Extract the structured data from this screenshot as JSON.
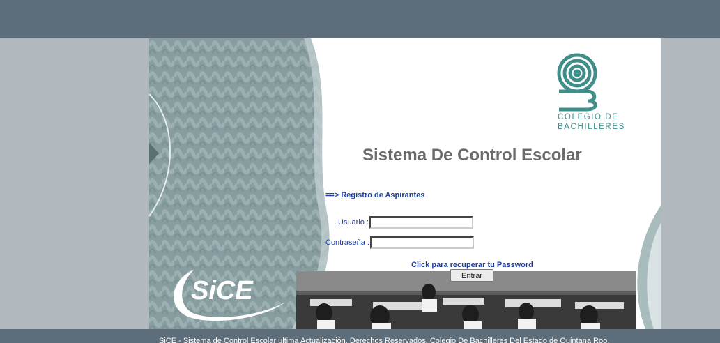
{
  "brand": {
    "logo_line1": "COLEGIO DE",
    "logo_line2": "BACHILLERES",
    "logo_color": "#3f8e8a",
    "sice_logo_text": "SiCE"
  },
  "header": {
    "title": "Sistema De Control Escolar"
  },
  "links": {
    "registro": "==> Registro de Aspirantes",
    "recover": "Click para recuperar tu Password"
  },
  "login": {
    "user_label": "Usuario :",
    "user_value": "",
    "pass_label": "Contraseña :",
    "pass_value": "",
    "submit_label": "Entrar"
  },
  "footer": {
    "text": "SiCE - Sistema de Control Escolar ultima Actualización. Derechos Reservados. Colegio De Bachilleres Del Estado de Quintana Roo."
  },
  "colors": {
    "header_bar": "#5d6d7a",
    "background": "#b1b8be",
    "link": "#1f3f9f",
    "title": "#6b6b6b"
  }
}
